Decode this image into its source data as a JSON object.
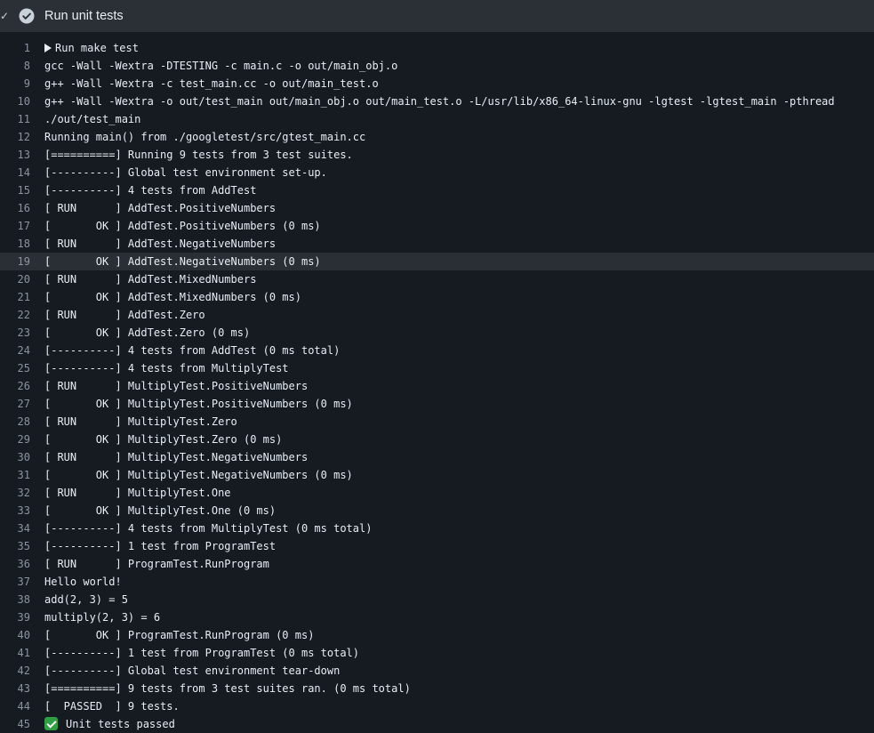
{
  "header": {
    "title": "Run unit tests",
    "status": "success",
    "status_color": "#8b949e",
    "chevron_icon": "chevron-down-icon",
    "status_icon": "check-circle-icon"
  },
  "log": {
    "highlighted_line": "19",
    "lines": [
      {
        "num": "1",
        "text": "Run make test",
        "kind": "group"
      },
      {
        "num": "8",
        "text": "gcc -Wall -Wextra -DTESTING -c main.c -o out/main_obj.o"
      },
      {
        "num": "9",
        "text": "g++ -Wall -Wextra -c test_main.cc -o out/main_test.o"
      },
      {
        "num": "10",
        "text": "g++ -Wall -Wextra -o out/test_main out/main_obj.o out/main_test.o -L/usr/lib/x86_64-linux-gnu -lgtest -lgtest_main -pthread"
      },
      {
        "num": "11",
        "text": "./out/test_main"
      },
      {
        "num": "12",
        "text": "Running main() from ./googletest/src/gtest_main.cc"
      },
      {
        "num": "13",
        "text": "[==========] Running 9 tests from 3 test suites."
      },
      {
        "num": "14",
        "text": "[----------] Global test environment set-up."
      },
      {
        "num": "15",
        "text": "[----------] 4 tests from AddTest"
      },
      {
        "num": "16",
        "text": "[ RUN      ] AddTest.PositiveNumbers"
      },
      {
        "num": "17",
        "text": "[       OK ] AddTest.PositiveNumbers (0 ms)"
      },
      {
        "num": "18",
        "text": "[ RUN      ] AddTest.NegativeNumbers"
      },
      {
        "num": "19",
        "text": "[       OK ] AddTest.NegativeNumbers (0 ms)"
      },
      {
        "num": "20",
        "text": "[ RUN      ] AddTest.MixedNumbers"
      },
      {
        "num": "21",
        "text": "[       OK ] AddTest.MixedNumbers (0 ms)"
      },
      {
        "num": "22",
        "text": "[ RUN      ] AddTest.Zero"
      },
      {
        "num": "23",
        "text": "[       OK ] AddTest.Zero (0 ms)"
      },
      {
        "num": "24",
        "text": "[----------] 4 tests from AddTest (0 ms total)"
      },
      {
        "num": "25",
        "text": "[----------] 4 tests from MultiplyTest"
      },
      {
        "num": "26",
        "text": "[ RUN      ] MultiplyTest.PositiveNumbers"
      },
      {
        "num": "27",
        "text": "[       OK ] MultiplyTest.PositiveNumbers (0 ms)"
      },
      {
        "num": "28",
        "text": "[ RUN      ] MultiplyTest.Zero"
      },
      {
        "num": "29",
        "text": "[       OK ] MultiplyTest.Zero (0 ms)"
      },
      {
        "num": "30",
        "text": "[ RUN      ] MultiplyTest.NegativeNumbers"
      },
      {
        "num": "31",
        "text": "[       OK ] MultiplyTest.NegativeNumbers (0 ms)"
      },
      {
        "num": "32",
        "text": "[ RUN      ] MultiplyTest.One"
      },
      {
        "num": "33",
        "text": "[       OK ] MultiplyTest.One (0 ms)"
      },
      {
        "num": "34",
        "text": "[----------] 4 tests from MultiplyTest (0 ms total)"
      },
      {
        "num": "35",
        "text": "[----------] 1 test from ProgramTest"
      },
      {
        "num": "36",
        "text": "[ RUN      ] ProgramTest.RunProgram"
      },
      {
        "num": "37",
        "text": "Hello world!"
      },
      {
        "num": "38",
        "text": "add(2, 3) = 5"
      },
      {
        "num": "39",
        "text": "multiply(2, 3) = 6"
      },
      {
        "num": "40",
        "text": "[       OK ] ProgramTest.RunProgram (0 ms)"
      },
      {
        "num": "41",
        "text": "[----------] 1 test from ProgramTest (0 ms total)"
      },
      {
        "num": "42",
        "text": "[----------] Global test environment tear-down"
      },
      {
        "num": "43",
        "text": "[==========] 9 tests from 3 test suites ran. (0 ms total)"
      },
      {
        "num": "44",
        "text": "[  PASSED  ] 9 tests."
      },
      {
        "num": "45",
        "text": "Unit tests passed",
        "kind": "success",
        "icon": "green-check-icon"
      }
    ]
  }
}
